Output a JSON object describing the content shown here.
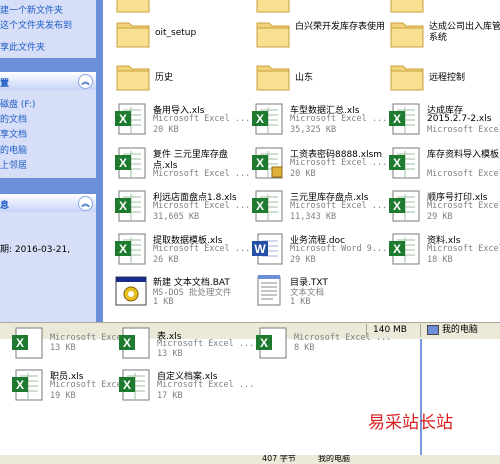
{
  "task_pane": {
    "file_tasks": [
      {
        "label": "建一个新文件夹"
      },
      {
        "label": "这个文件夹发布到"
      },
      {
        "label": "享此文件夹"
      }
    ],
    "other_places_title": "置",
    "other_places": [
      {
        "label": "磁盘 (F:)"
      },
      {
        "label": "的文档"
      },
      {
        "label": "享文档"
      },
      {
        "label": "的电脑"
      },
      {
        "label": "上邻居"
      }
    ],
    "details_title": "息",
    "details_text": "期: 2016-03-21,"
  },
  "folders": [
    {
      "name": "oit_setup"
    },
    {
      "name": "白兴荣开发库存表使用"
    },
    {
      "name": "达成公司出入库管系统"
    },
    {
      "name": "历史"
    },
    {
      "name": "山东"
    },
    {
      "name": "远程控制"
    }
  ],
  "files": [
    {
      "name": "备用导入.xls",
      "type": "Microsoft Excel ...",
      "size": "20 KB",
      "icon": "excel-icon"
    },
    {
      "name": "车型数据汇总.xls",
      "type": "Microsoft Excel ...",
      "size": "35,325 KB",
      "icon": "excel-icon"
    },
    {
      "name": "达成库存",
      "name2": "2015.2.7-2.xls",
      "type": "Microsoft Excel ...",
      "size": "",
      "icon": "excel-icon"
    },
    {
      "name": "复件 三元里库存盘",
      "name2": "点.xls",
      "type": "Microsoft Excel ...",
      "size": "",
      "icon": "excel-icon"
    },
    {
      "name": "工资表密码8888.xlsm",
      "type": "Microsoft Excel ...",
      "size": "20 KB",
      "icon": "excel-lock-icon"
    },
    {
      "name": "库存资料导入模板",
      "type": "Microsoft Excel ...",
      "size": "",
      "icon": "excel-icon"
    },
    {
      "name": "利远店面盘点1.8.xls",
      "type": "Microsoft Excel ...",
      "size": "31,605 KB",
      "icon": "excel-icon"
    },
    {
      "name": "三元里库存盘点.xls",
      "type": "Microsoft Excel ...",
      "size": "11,343 KB",
      "icon": "excel-icon"
    },
    {
      "name": "顺序号打印.xls",
      "type": "Microsoft Excel ...",
      "size": "29 KB",
      "icon": "excel-icon"
    },
    {
      "name": "提取数据模板.xls",
      "type": "Microsoft Excel ...",
      "size": "26 KB",
      "icon": "excel-icon"
    },
    {
      "name": "业务流程.doc",
      "type": "Microsoft Word 9...",
      "size": "29 KB",
      "icon": "word-icon"
    },
    {
      "name": "资料.xls",
      "type": "Microsoft Excel ...",
      "size": "18 KB",
      "icon": "excel-icon"
    },
    {
      "name": "新建 文本文档.BAT",
      "type": "MS-DOS 批处理文件",
      "size": "1 KB",
      "icon": "batch-icon"
    },
    {
      "name": "目录.TXT",
      "type": "文本文档",
      "size": "1 KB",
      "icon": "text-icon"
    }
  ],
  "status": {
    "size": "140 MB",
    "location": "我的电脑"
  },
  "bottom_window": {
    "files": [
      {
        "name": "",
        "type": "Microsoft Excel ...",
        "size": "13 KB"
      },
      {
        "name": "表.xls",
        "type": "Microsoft Excel ...",
        "size": "13 KB"
      },
      {
        "name": "",
        "type": "Microsoft Excel ...",
        "size": "8 KB"
      },
      {
        "name": "职员.xls",
        "type": "Microsoft Excel ...",
        "size": "19 KB"
      },
      {
        "name": "自定义档案.xls",
        "type": "Microsoft Excel ...",
        "size": "17 KB"
      }
    ],
    "status_left": "407 字节",
    "status_right": "我的电脑"
  },
  "watermark": {
    "text": "易采站长站",
    "color": "#d81e1e"
  }
}
